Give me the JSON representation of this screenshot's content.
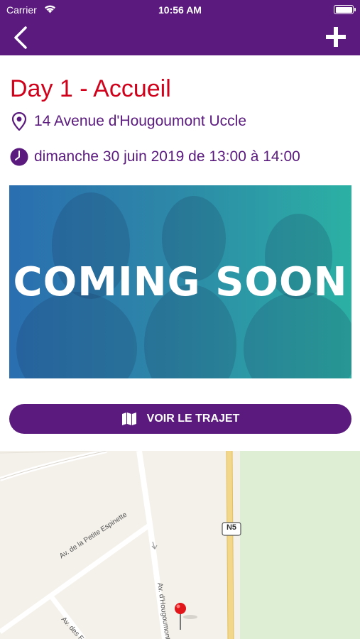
{
  "status_bar": {
    "carrier": "Carrier",
    "time": "10:56 AM",
    "wifi_icon": "wifi-icon",
    "battery_icon": "battery-icon"
  },
  "navbar": {
    "back_icon": "chevron-left-icon",
    "add_icon": "plus-icon",
    "color": "#5a1a7e"
  },
  "event": {
    "title": "Day 1 - Accueil",
    "address": "14 Avenue d'Hougoumont Uccle",
    "datetime": "dimanche 30 juin 2019  de 13:00 à 14:00",
    "title_color": "#d0021b"
  },
  "banner": {
    "text": "COMING SOON"
  },
  "route_button": {
    "label": "VOIR LE TRAJET",
    "icon": "map-icon"
  },
  "map": {
    "road_badge": "N5",
    "labels": {
      "petite_espinette": "Av. de la Petite Espinette",
      "hougoumont": "Av. d'Hougoumont",
      "des": "Av. des F"
    },
    "pin_icon": "map-pin-icon"
  }
}
